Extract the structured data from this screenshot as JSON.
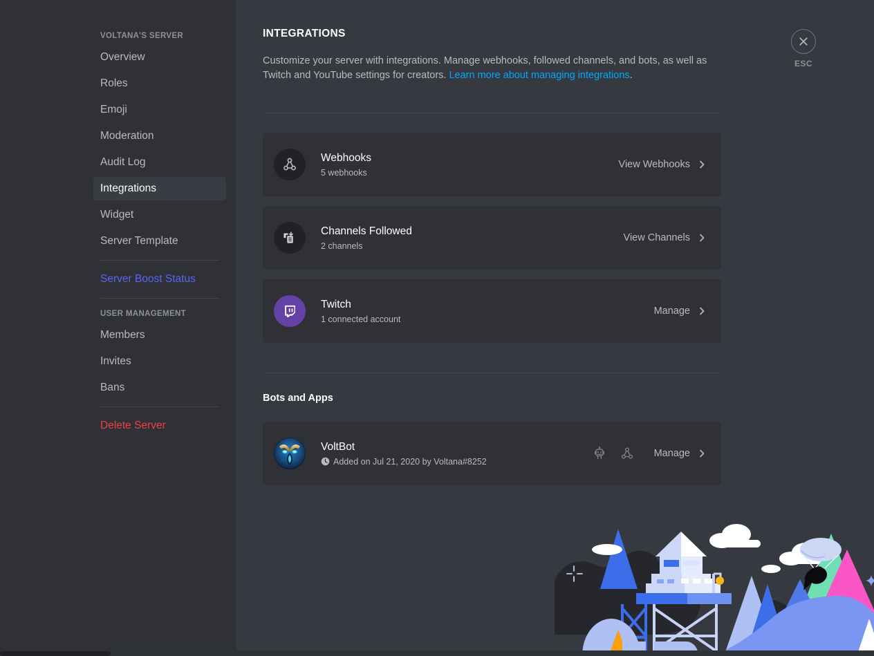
{
  "sidebar": {
    "server_header": "VOLTANA'S SERVER",
    "items": [
      {
        "label": "Overview",
        "state": "normal"
      },
      {
        "label": "Roles",
        "state": "normal"
      },
      {
        "label": "Emoji",
        "state": "normal"
      },
      {
        "label": "Moderation",
        "state": "normal"
      },
      {
        "label": "Audit Log",
        "state": "normal"
      },
      {
        "label": "Integrations",
        "state": "active"
      },
      {
        "label": "Widget",
        "state": "normal"
      },
      {
        "label": "Server Template",
        "state": "normal"
      }
    ],
    "boost_label": "Server Boost Status",
    "user_management_header": "USER MANAGEMENT",
    "user_items": [
      {
        "label": "Members"
      },
      {
        "label": "Invites"
      },
      {
        "label": "Bans"
      }
    ],
    "delete_label": "Delete Server"
  },
  "header": {
    "title": "INTEGRATIONS",
    "description_part1": "Customize your server with integrations. Manage webhooks, followed channels, and bots, as well as Twitch and YouTube settings for creators. ",
    "link_text": "Learn more about managing integrations",
    "description_end": "."
  },
  "close": {
    "icon": "close-icon",
    "label": "ESC"
  },
  "integration_cards": [
    {
      "name": "Webhooks",
      "subtitle": "5 webhooks",
      "action": "View Webhooks",
      "icon": "webhook-icon",
      "icon_bg": "#202225"
    },
    {
      "name": "Channels Followed",
      "subtitle": "2 channels",
      "action": "View Channels",
      "icon": "channels-followed-icon",
      "icon_bg": "#202225"
    },
    {
      "name": "Twitch",
      "subtitle": "1 connected account",
      "action": "Manage",
      "icon": "twitch-icon",
      "icon_bg": "#6441a5"
    }
  ],
  "bots_section": {
    "title": "Bots and Apps",
    "bot": {
      "name": "VoltBot",
      "meta": "Added on Jul 21, 2020 by Voltana#8252",
      "meta_icon": "clock-icon",
      "action": "Manage",
      "icons": [
        "robot-icon",
        "webhook-icon"
      ]
    }
  },
  "colors": {
    "sidebar_bg": "#2f3136",
    "main_bg": "#36393f",
    "card_bg": "#2f3136",
    "accent_blue": "#5865f2",
    "link_blue": "#00a8fc",
    "danger_red": "#ed4245",
    "twitch_purple": "#6441a5",
    "text_primary": "#ffffff",
    "text_secondary": "#b9bbbe",
    "text_muted": "#8e9297"
  },
  "illustration": {
    "name": "discord-watchtower-mountains-illustration",
    "elements": [
      "watchtower",
      "mountains",
      "clouds",
      "parachutist",
      "sparkles",
      "tents"
    ]
  }
}
